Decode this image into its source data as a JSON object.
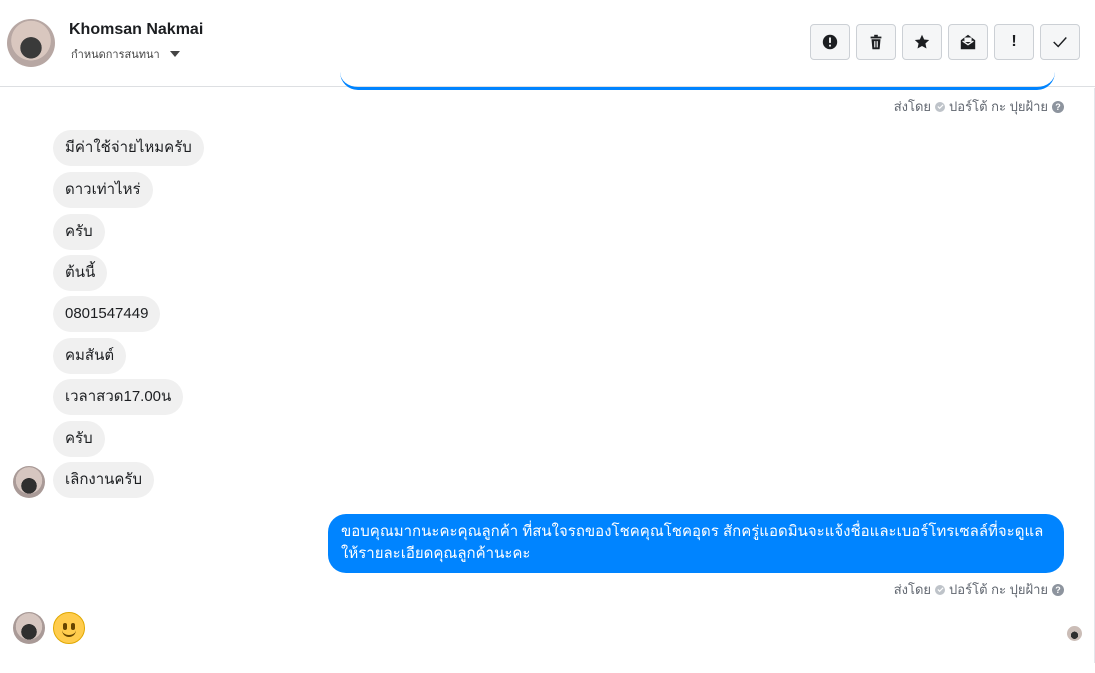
{
  "header": {
    "name": "Khomsan Nakmai",
    "assign_label": "กำหนดการสนทนา",
    "tools": [
      {
        "icon": "alert-circle-icon"
      },
      {
        "icon": "trash-icon"
      },
      {
        "icon": "star-icon"
      },
      {
        "icon": "mail-open-icon"
      },
      {
        "icon": "exclamation-icon",
        "text": "!"
      },
      {
        "icon": "check-icon"
      }
    ]
  },
  "sent_by": {
    "prefix": "ส่งโดย",
    "sender": "ปอร์โต้ กะ ปุยฝ้าย",
    "help": "?"
  },
  "incoming": [
    "มีค่าใช้จ่ายไหมครับ",
    "ดาวเท่าไหร่",
    "ครับ",
    "ต้นนี้",
    "0801547449",
    "คมสันต์",
    "เวลาสวด17.00น",
    "ครับ",
    "เลิกงานครับ"
  ],
  "outgoing": {
    "text": "ขอบคุณมากนะคะคุณลูกค้า ที่สนใจรถของโชคคุณโชคอุดร สักครู่แอดมินจะแจ้งชื่อและเบอร์โทรเซลล์ที่จะดูแลให้รายละเอียดคุณลูกค้านะคะ"
  },
  "colors": {
    "outgoing_bubble": "#0084ff",
    "incoming_bubble": "#f0f0f0"
  }
}
